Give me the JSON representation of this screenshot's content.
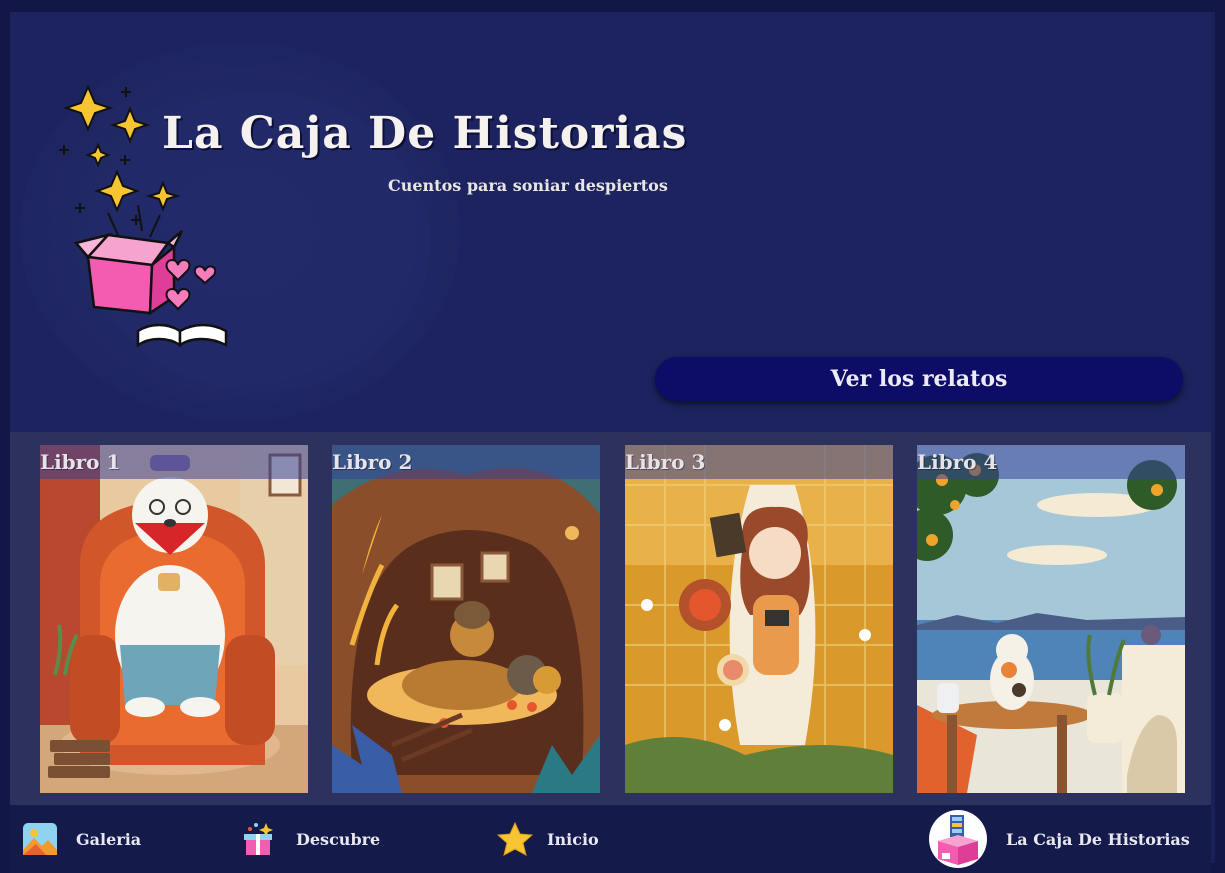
{
  "header": {
    "title": "La Caja De Historias",
    "subtitle": "Cuentos para soniar despiertos",
    "cta_label": "Ver los relatos",
    "accent_color": "#0d0c66"
  },
  "books": [
    {
      "label": "Libro 1",
      "illustration": "polar-bear-armchair"
    },
    {
      "label": "Libro 2",
      "illustration": "bear-tree-hollow"
    },
    {
      "label": "Libro 3",
      "illustration": "girl-hammock-picnic"
    },
    {
      "label": "Libro 4",
      "illustration": "cat-terrace-sea"
    }
  ],
  "nav": {
    "items": [
      {
        "label": "Galeria",
        "icon": "gallery-icon"
      },
      {
        "label": "Descubre",
        "icon": "gift-icon"
      },
      {
        "label": "Inicio",
        "icon": "star-icon"
      }
    ],
    "brand_label": "La Caja De Historias",
    "brand_icon": "story-box-icon"
  }
}
